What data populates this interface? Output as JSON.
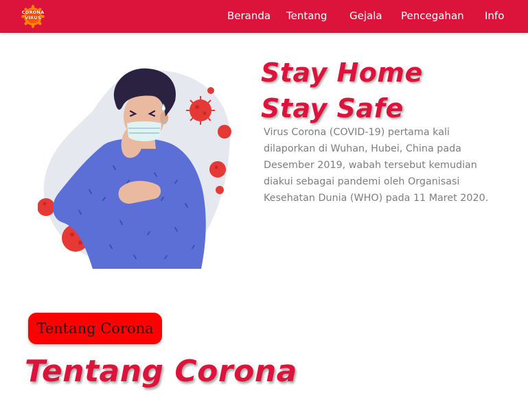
{
  "navbar": {
    "logo_text_line1": "CORONA",
    "logo_text_line2": "VIRUS",
    "items": [
      {
        "label": "Beranda"
      },
      {
        "label": "Tentang"
      },
      {
        "label": "Gejala"
      },
      {
        "label": "Pencegahan"
      },
      {
        "label": "Info"
      }
    ]
  },
  "hero": {
    "title_line1": "Stay Home",
    "title_line2": "Stay Safe",
    "description": "Virus Corona (COVID-19) pertama kali dilaporkan di Wuhan, Hubei, China pada Desember 2019, wabah tersebut kemudian diakui sebagai pandemi oleh Organisasi Kesehatan Dunia (WHO) pada 11 Maret 2020."
  },
  "about": {
    "badge_label": "Tentang Corona",
    "title": "Tentang Corona"
  },
  "colors": {
    "brand": "#dc143c",
    "badge": "#ff0000",
    "text_muted": "#7d7d7d",
    "sweater": "#5b6fd6",
    "virus": "#e53935"
  },
  "icons": {
    "logo": "corona-virus-logo-icon",
    "illustration": "coughing-man-illustration"
  }
}
